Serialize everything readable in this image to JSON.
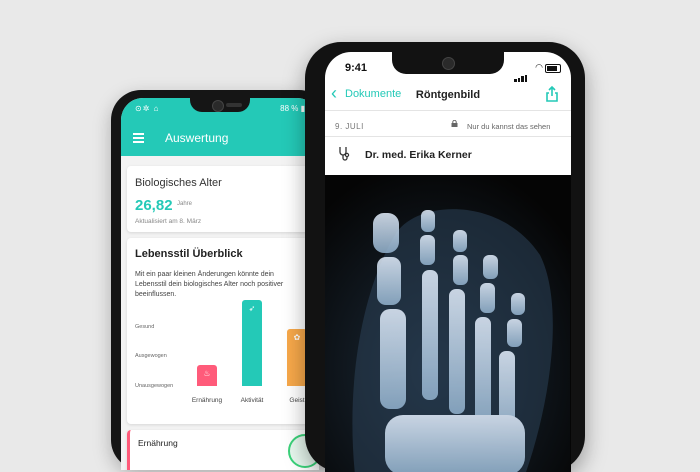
{
  "back_phone": {
    "status_left": "⊙✲ ⌂",
    "status_right": "88 % ▮",
    "app_title": "Auswertung",
    "bio_age": {
      "title": "Biologisches Alter",
      "value": "26,82",
      "unit": "Jahre",
      "updated": "Aktualisiert am 8. März"
    },
    "lifestyle": {
      "title": "Lebensstil Überblick",
      "description": "Mit ein paar kleinen Änderungen könnte dein Lebensstil dein biologisches Alter noch positiver beeinflussen.",
      "levels": [
        "Gesund",
        "Ausgewogen",
        "Unausgewogen"
      ],
      "bars": [
        {
          "label": "Ernährung",
          "level": 0.22,
          "color": "#ff5b7a",
          "icon": "food-icon"
        },
        {
          "label": "Aktivität",
          "level": 0.9,
          "color": "#24c9b7",
          "icon": "shoe-icon"
        },
        {
          "label": "Geist",
          "level": 0.6,
          "color": "#f7a84a",
          "icon": "brain-icon"
        }
      ]
    },
    "nutrition_card": {
      "title": "Ernährung"
    }
  },
  "front_phone": {
    "time": "9:41",
    "back_label": "Dokumente",
    "title": "Röntgenbild",
    "date": "9. JULI",
    "privacy": "Nur du kannst das sehen",
    "doctor": "Dr. med. Erika Kerner"
  },
  "colors": {
    "accent": "#24c9b7",
    "background": "#e9e9e9",
    "nutrition": "#ff5b7a",
    "activity": "#24c9b7",
    "mind": "#f7a84a"
  }
}
